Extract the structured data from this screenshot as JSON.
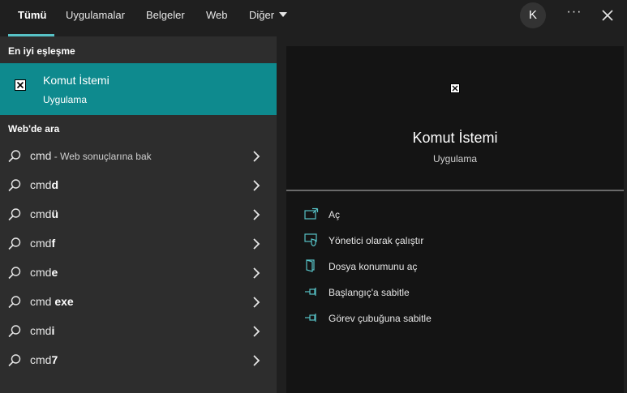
{
  "tabs": [
    {
      "label": "Tümü",
      "active": true
    },
    {
      "label": "Uygulamalar"
    },
    {
      "label": "Belgeler"
    },
    {
      "label": "Web"
    },
    {
      "label": "Diğer"
    }
  ],
  "header": {
    "avatar_letter": "K",
    "more_label": "···"
  },
  "left": {
    "best_match_title": "En iyi eşleşme",
    "best_match": {
      "name": "Komut İstemi",
      "type": "Uygulama"
    },
    "web_title": "Web'de ara",
    "results": [
      {
        "base": "cmd",
        "bold": "",
        "suffix": " - Web sonuçlarına bak"
      },
      {
        "base": "cmd",
        "bold": "d",
        "suffix": ""
      },
      {
        "base": "cmd",
        "bold": "ü",
        "suffix": ""
      },
      {
        "base": "cmd",
        "bold": "f",
        "suffix": ""
      },
      {
        "base": "cmd",
        "bold": "e",
        "suffix": ""
      },
      {
        "base": "cmd ",
        "bold": "exe",
        "suffix": ""
      },
      {
        "base": "cmd",
        "bold": "i",
        "suffix": ""
      },
      {
        "base": "cmd",
        "bold": "7",
        "suffix": ""
      }
    ]
  },
  "right": {
    "app_name": "Komut İstemi",
    "app_type": "Uygulama",
    "actions": [
      {
        "label": "Aç",
        "icon": "open-icon"
      },
      {
        "label": "Yönetici olarak çalıştır",
        "icon": "shield-icon"
      },
      {
        "label": "Dosya konumunu aç",
        "icon": "folder-icon"
      },
      {
        "label": "Başlangıç'a sabitle",
        "icon": "pin-icon"
      },
      {
        "label": "Görev çubuğuna sabitle",
        "icon": "pin-icon"
      }
    ]
  },
  "colors": {
    "accent": "#57c2c6",
    "selected": "#0e8a8e",
    "left_bg": "#2d2d2d",
    "right_bg": "#141414"
  }
}
